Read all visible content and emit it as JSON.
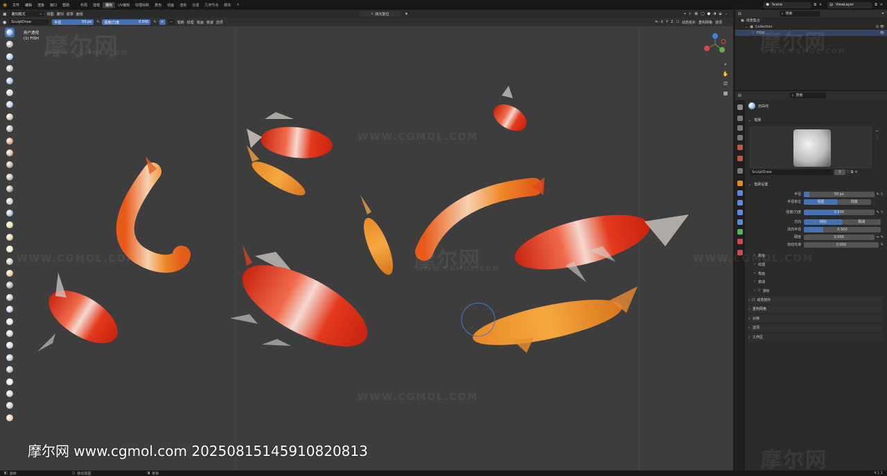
{
  "menu": [
    "文件",
    "编辑",
    "渲染",
    "窗口",
    "帮助"
  ],
  "workspace_tabs": [
    "布局",
    "建模",
    "雕刻",
    "UV编辑",
    "纹理绘制",
    "着色",
    "动画",
    "渲染",
    "合成",
    "几何节点",
    "脚本"
  ],
  "active_workspace": "雕刻",
  "add_tab": "+",
  "scene": {
    "name": "Scene",
    "view_layer": "ViewLayer"
  },
  "tool_header": {
    "mode": "雕刻模式",
    "menus": [
      "视图",
      "雕刻",
      "遮罩",
      "面组"
    ],
    "brush_name": "SculptDraw",
    "radius_label": "半径",
    "radius_value": "50 px",
    "strength_label": "强度/力度",
    "strength_value": "0.500",
    "plus": "+",
    "minus": "−",
    "dropdowns": [
      "笔刷",
      "纹理",
      "笔画",
      "衰减",
      "选项"
    ],
    "search_placeholder": "四元复位",
    "axes": [
      "X",
      "Y",
      "Z"
    ],
    "dynamic_topology": "动态拓扑",
    "remesh": "重构网格",
    "options": "选项"
  },
  "viewport": {
    "view_name": "用户透视",
    "object_name": "(1) FISH",
    "watermarks": {
      "url": "WWW.CGMOL.COM",
      "logo": "摩尔网"
    }
  },
  "credit_text": "摩尔网 www.cgmol.com 20250815145910820813",
  "outliner": {
    "search_placeholder": "搜索",
    "scene_collection": "场景集合",
    "collection": "Collection",
    "object": "FISH"
  },
  "properties": {
    "search_placeholder": "搜索",
    "brush_label": "自由线",
    "brush_panel": "笔刷",
    "brush_name": "SculptDraw",
    "brush_users": "2",
    "settings_panel": "笔刷设置",
    "rows": [
      {
        "label": "半径",
        "value": "50 px"
      },
      {
        "label": "半径单位",
        "value": "视图",
        "value2": "场景"
      },
      {
        "label": "强度/力度",
        "value": "0.500"
      },
      {
        "label": "方向",
        "value": "相加",
        "value2": "相减"
      },
      {
        "label": "法向半径",
        "value": "0.500"
      },
      {
        "label": "硬度",
        "value": "0.000"
      },
      {
        "label": "自动光滑",
        "value": "0.000"
      }
    ],
    "subpanels": [
      "高级",
      "纹理",
      "笔画",
      "衰减",
      "游标"
    ],
    "panels": [
      "动态拓扑",
      "重构网格",
      "对称",
      "选项",
      "工作区"
    ]
  },
  "statusbar": {
    "left": "旋转",
    "mid": "移动视图",
    "right": "菜单",
    "version": "4.1.1"
  },
  "colors": {
    "accent": "#4672b4",
    "viewport_bg": "#3d3d3d",
    "koi_red": "#e03a1c",
    "koi_orange": "#f09a2c"
  }
}
